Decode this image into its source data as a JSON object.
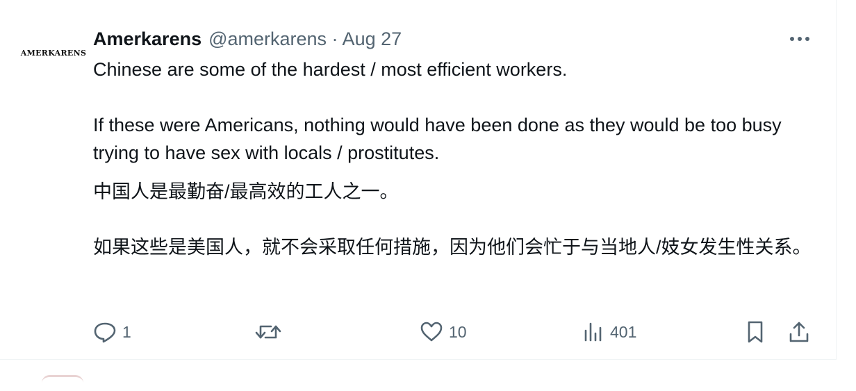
{
  "tweet": {
    "avatar_text": "AMERKARENS",
    "display_name": "Amerkarens",
    "handle_date": "@amerkarens · Aug 27",
    "english_paragraphs": [
      "Chinese are some of the hardest / most efficient workers.",
      "If these were Americans, nothing would have been done as they would be too busy trying to have sex with locals / prostitutes."
    ],
    "chinese_paragraphs": [
      "中国人是最勤奋/最高效的工人之一。",
      "如果这些是美国人，就不会采取任何措施，因为他们会忙于与当地人/妓女发生性关系。"
    ],
    "actions": {
      "reply_count": "1",
      "retweet_count": "",
      "like_count": "10",
      "views_count": "401"
    }
  },
  "icons": {
    "more": "more-dots-icon",
    "reply": "reply-icon",
    "retweet": "retweet-icon",
    "like": "heart-icon",
    "views": "views-chart-icon",
    "bookmark": "bookmark-icon",
    "share": "share-icon"
  },
  "colors": {
    "text_primary": "#0f1419",
    "text_secondary": "#536471"
  }
}
